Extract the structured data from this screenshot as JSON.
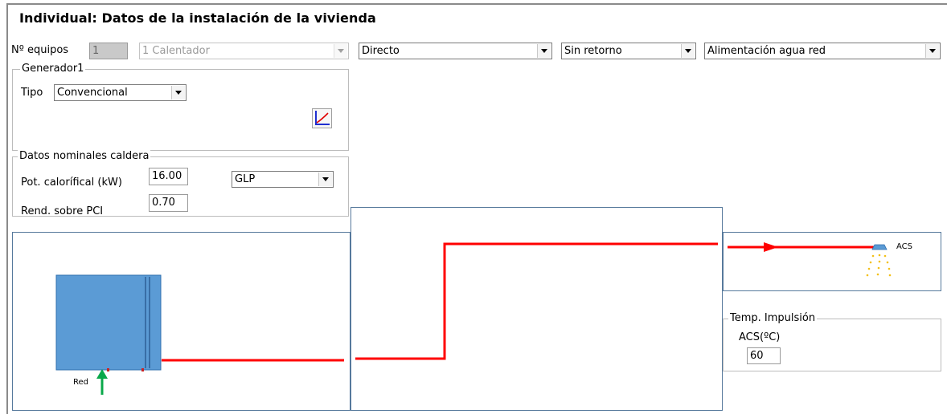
{
  "title": "Individual: Datos de la instalación de la vivienda",
  "toolbar": {
    "equipos_label": "Nº equipos",
    "equipos_value": "1",
    "generator_select": "1 Calentador",
    "mode_select": "Directo",
    "return_select": "Sin retorno",
    "supply_select": "Alimentación agua red"
  },
  "generador": {
    "title": "Generador1",
    "tipo_label": "Tipo",
    "tipo_value": "Convencional",
    "chart_icon": "performance-curve-icon"
  },
  "caldera": {
    "title": "Datos nominales caldera",
    "pot_label": "Pot. calorífical (kW)",
    "pot_value": "16.00",
    "fuel_value": "GLP",
    "rend_label": "Rend. sobre PCI",
    "rend_value": "0.70"
  },
  "diagram": {
    "red_label": "Red",
    "acs_label": "ACS",
    "pipe_color": "#ff0000",
    "tank_color": "#5b9bd5",
    "inlet_arrow_color": "#0aa84a",
    "shower_icon": "shower-icon"
  },
  "temp": {
    "title": "Temp. Impulsión",
    "acs_label": "ACS(ºC)",
    "acs_value": "60"
  }
}
